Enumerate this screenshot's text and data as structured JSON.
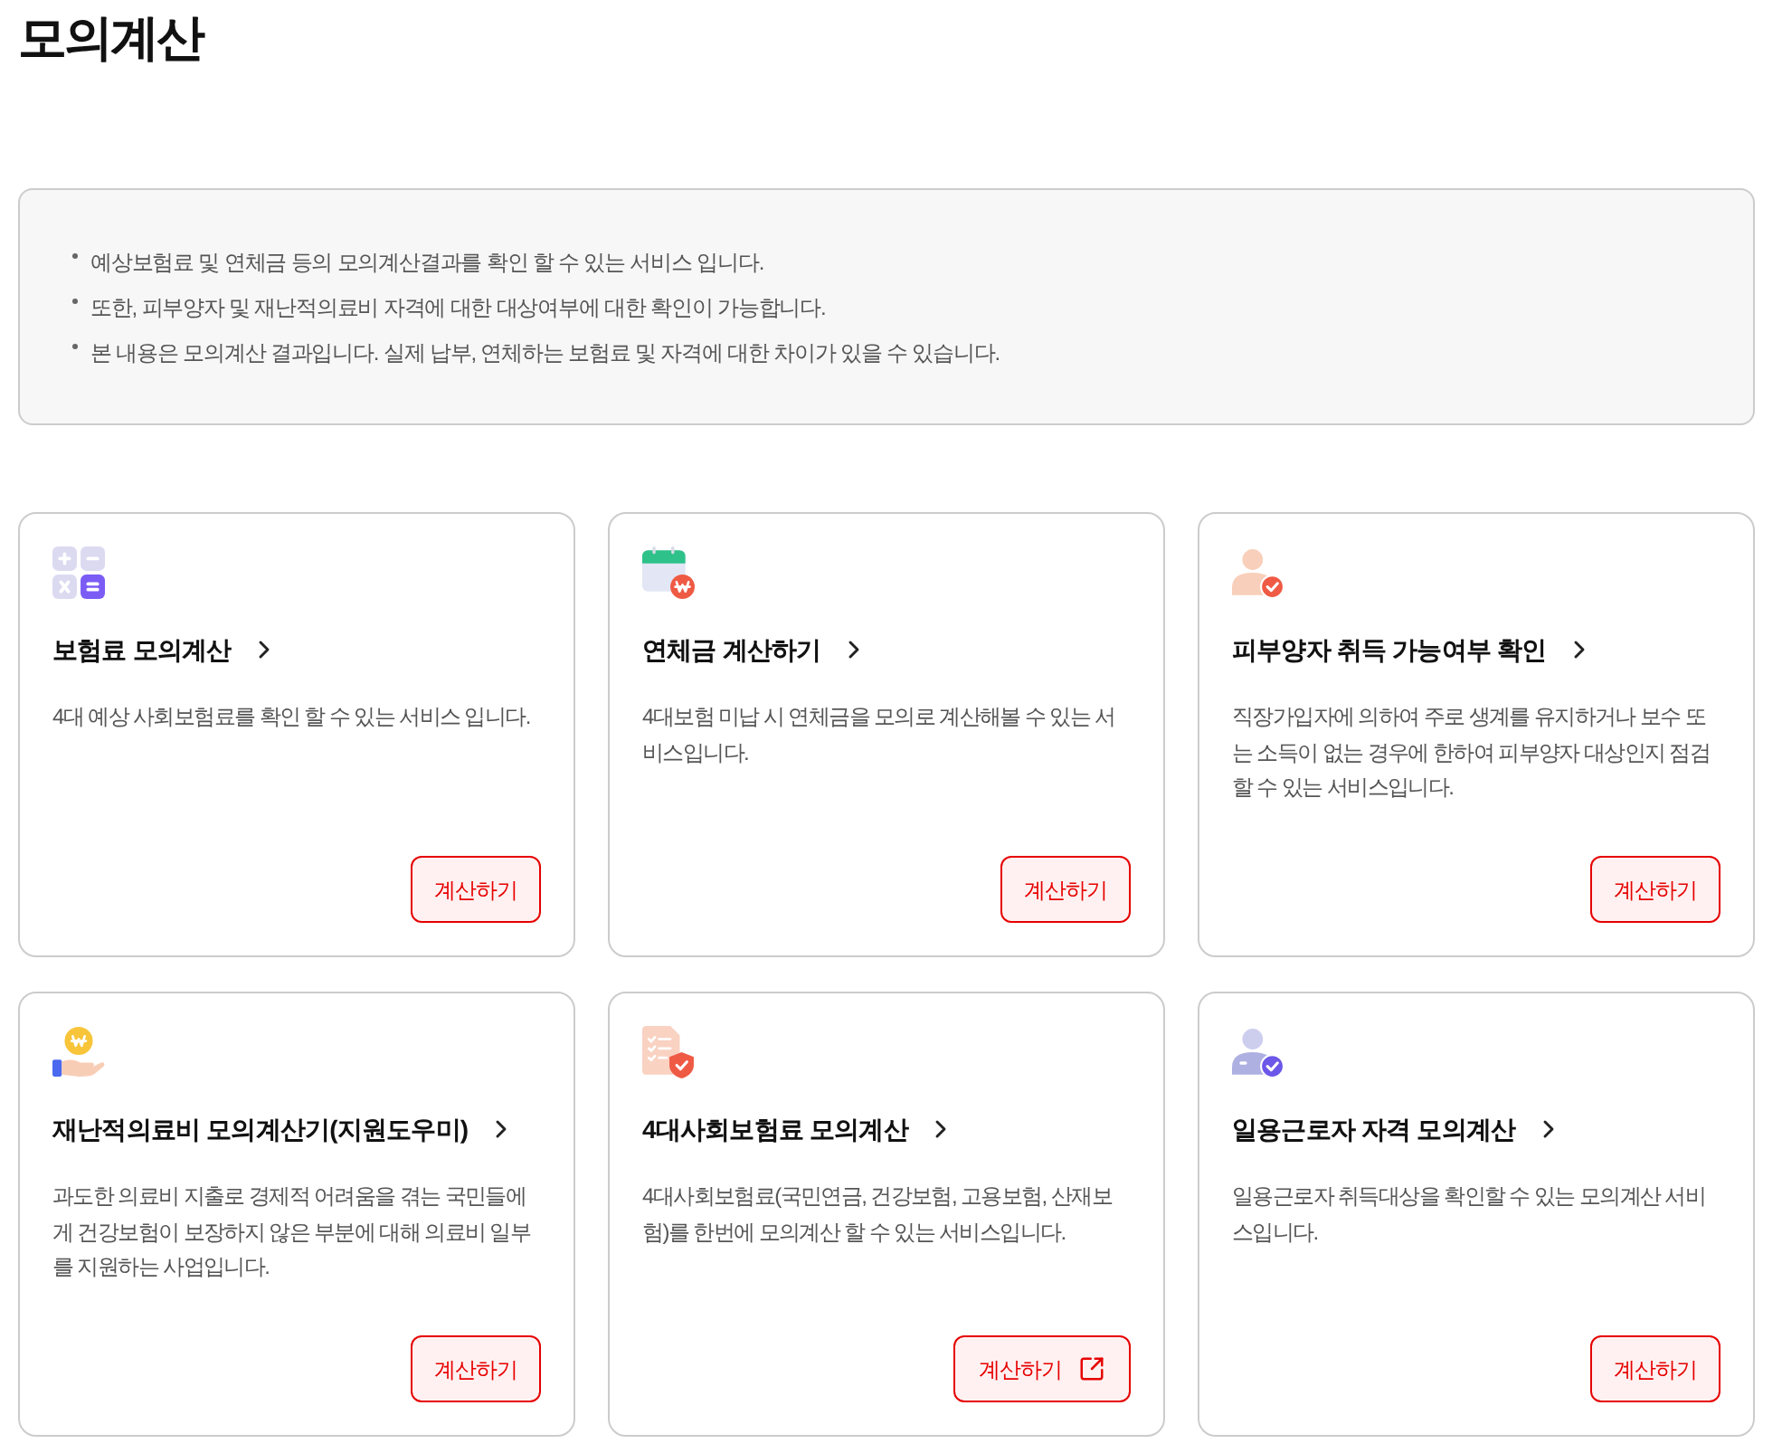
{
  "page_title": "모의계산",
  "notice": {
    "items": [
      "예상보험료 및 연체금 등의 모의계산결과를 확인 할 수 있는 서비스 입니다.",
      "또한, 피부양자 및 재난적의료비 자격에 대한 대상여부에 대한 확인이 가능합니다.",
      "본 내용은 모의계산 결과입니다. 실제 납부, 연체하는 보험료 및 자격에 대한 차이가 있을 수 있습니다."
    ]
  },
  "cards": [
    {
      "title": "보험료 모의계산",
      "description": "4대 예상 사회보험료를 확인 할 수 있는 서비스 입니다.",
      "button": {
        "label": "계산하기",
        "external": false
      }
    },
    {
      "title": "연체금 계산하기",
      "description": "4대보험 미납 시 연체금을 모의로 계산해볼 수 있는 서비스입니다.",
      "button": {
        "label": "계산하기",
        "external": false
      }
    },
    {
      "title": "피부양자 취득 가능여부 확인",
      "description": "직장가입자에 의하여 주로 생계를 유지하거나 보수 또는 소득이 없는 경우에 한하여 피부양자 대상인지 점검할 수 있는 서비스입니다.",
      "button": {
        "label": "계산하기",
        "external": false
      }
    },
    {
      "title": "재난적의료비 모의계산기(지원도우미)",
      "description": "과도한 의료비 지출로 경제적 어려움을 겪는 국민들에게 건강보험이 보장하지 않은 부분에 대해 의료비 일부를 지원하는 사업입니다.",
      "button": {
        "label": "계산하기",
        "external": false
      }
    },
    {
      "title": "4대사회보험료 모의계산",
      "description": "4대사회보험료(국민연금, 건강보험, 고용보험, 산재보험)를 한번에 모의계산 할 수 있는 서비스입니다.",
      "button": {
        "label": "계산하기",
        "external": true
      }
    },
    {
      "title": "일용근로자 자격 모의계산",
      "description": "일용근로자 취득대상을 확인할 수 있는 모의계산 서비스입니다.",
      "button": {
        "label": "계산하기",
        "external": false
      }
    }
  ]
}
